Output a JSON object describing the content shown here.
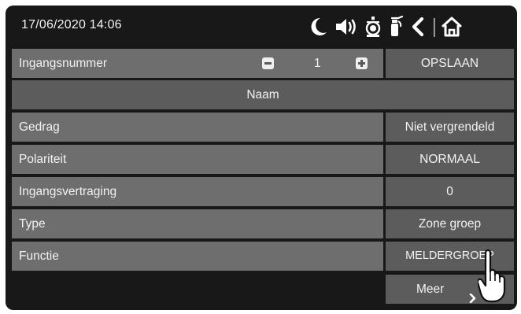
{
  "status_bar": {
    "datetime": "17/06/2020 14:06",
    "icons": [
      "moon-icon",
      "speaker-icon",
      "alarm-bell-icon",
      "fire-extinguisher-icon",
      "back-icon",
      "home-icon"
    ]
  },
  "input": {
    "label": "Ingangsnummer",
    "value": "1",
    "save_label": "OPSLAAN"
  },
  "name_label": "Naam",
  "settings": [
    {
      "label": "Gedrag",
      "value": "Niet vergrendeld"
    },
    {
      "label": "Polariteit",
      "value": "NORMAAL"
    },
    {
      "label": "Ingangsvertraging",
      "value": "0"
    },
    {
      "label": "Type",
      "value": "Zone groep"
    },
    {
      "label": "Functie",
      "value": "MELDERGROEP BRAND"
    }
  ],
  "more_label": "Meer",
  "colors": {
    "screen_bg": "#181818",
    "label_bg": "#6e6e6e",
    "value_bg": "#5c5c5c",
    "text": "#f2f2f2"
  }
}
